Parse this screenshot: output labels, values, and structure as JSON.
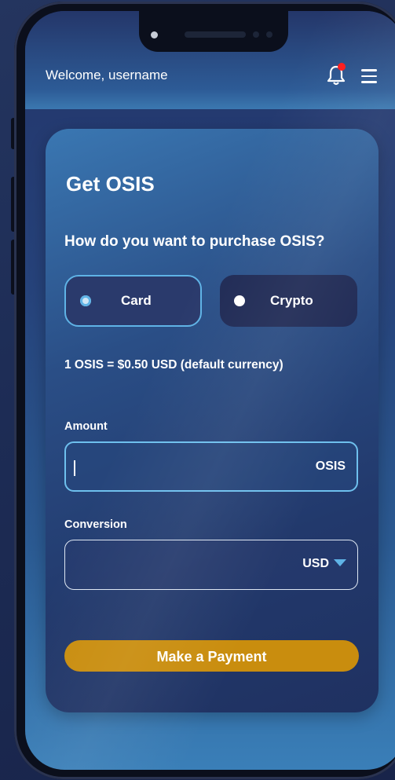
{
  "header": {
    "welcome_text": "Welcome, username",
    "icons": [
      "bell-icon",
      "notification-dot",
      "hamburger-menu-icon"
    ]
  },
  "card": {
    "title": "Get OSIS",
    "question": "How do you want to purchase OSIS?",
    "options": [
      {
        "label": "Card",
        "selected": true
      },
      {
        "label": "Crypto",
        "selected": false
      }
    ],
    "rate_text": "1 OSIS = $0.50 USD (default currency)",
    "amount": {
      "label": "Amount",
      "value": "",
      "suffix": "OSIS"
    },
    "conversion": {
      "label": "Conversion",
      "value": "",
      "currency": "USD"
    },
    "pay_button": "Make a Payment"
  },
  "colors": {
    "accent": "#5fb3e6",
    "button": "#c98d0e",
    "notification": "#ff1a1a"
  }
}
